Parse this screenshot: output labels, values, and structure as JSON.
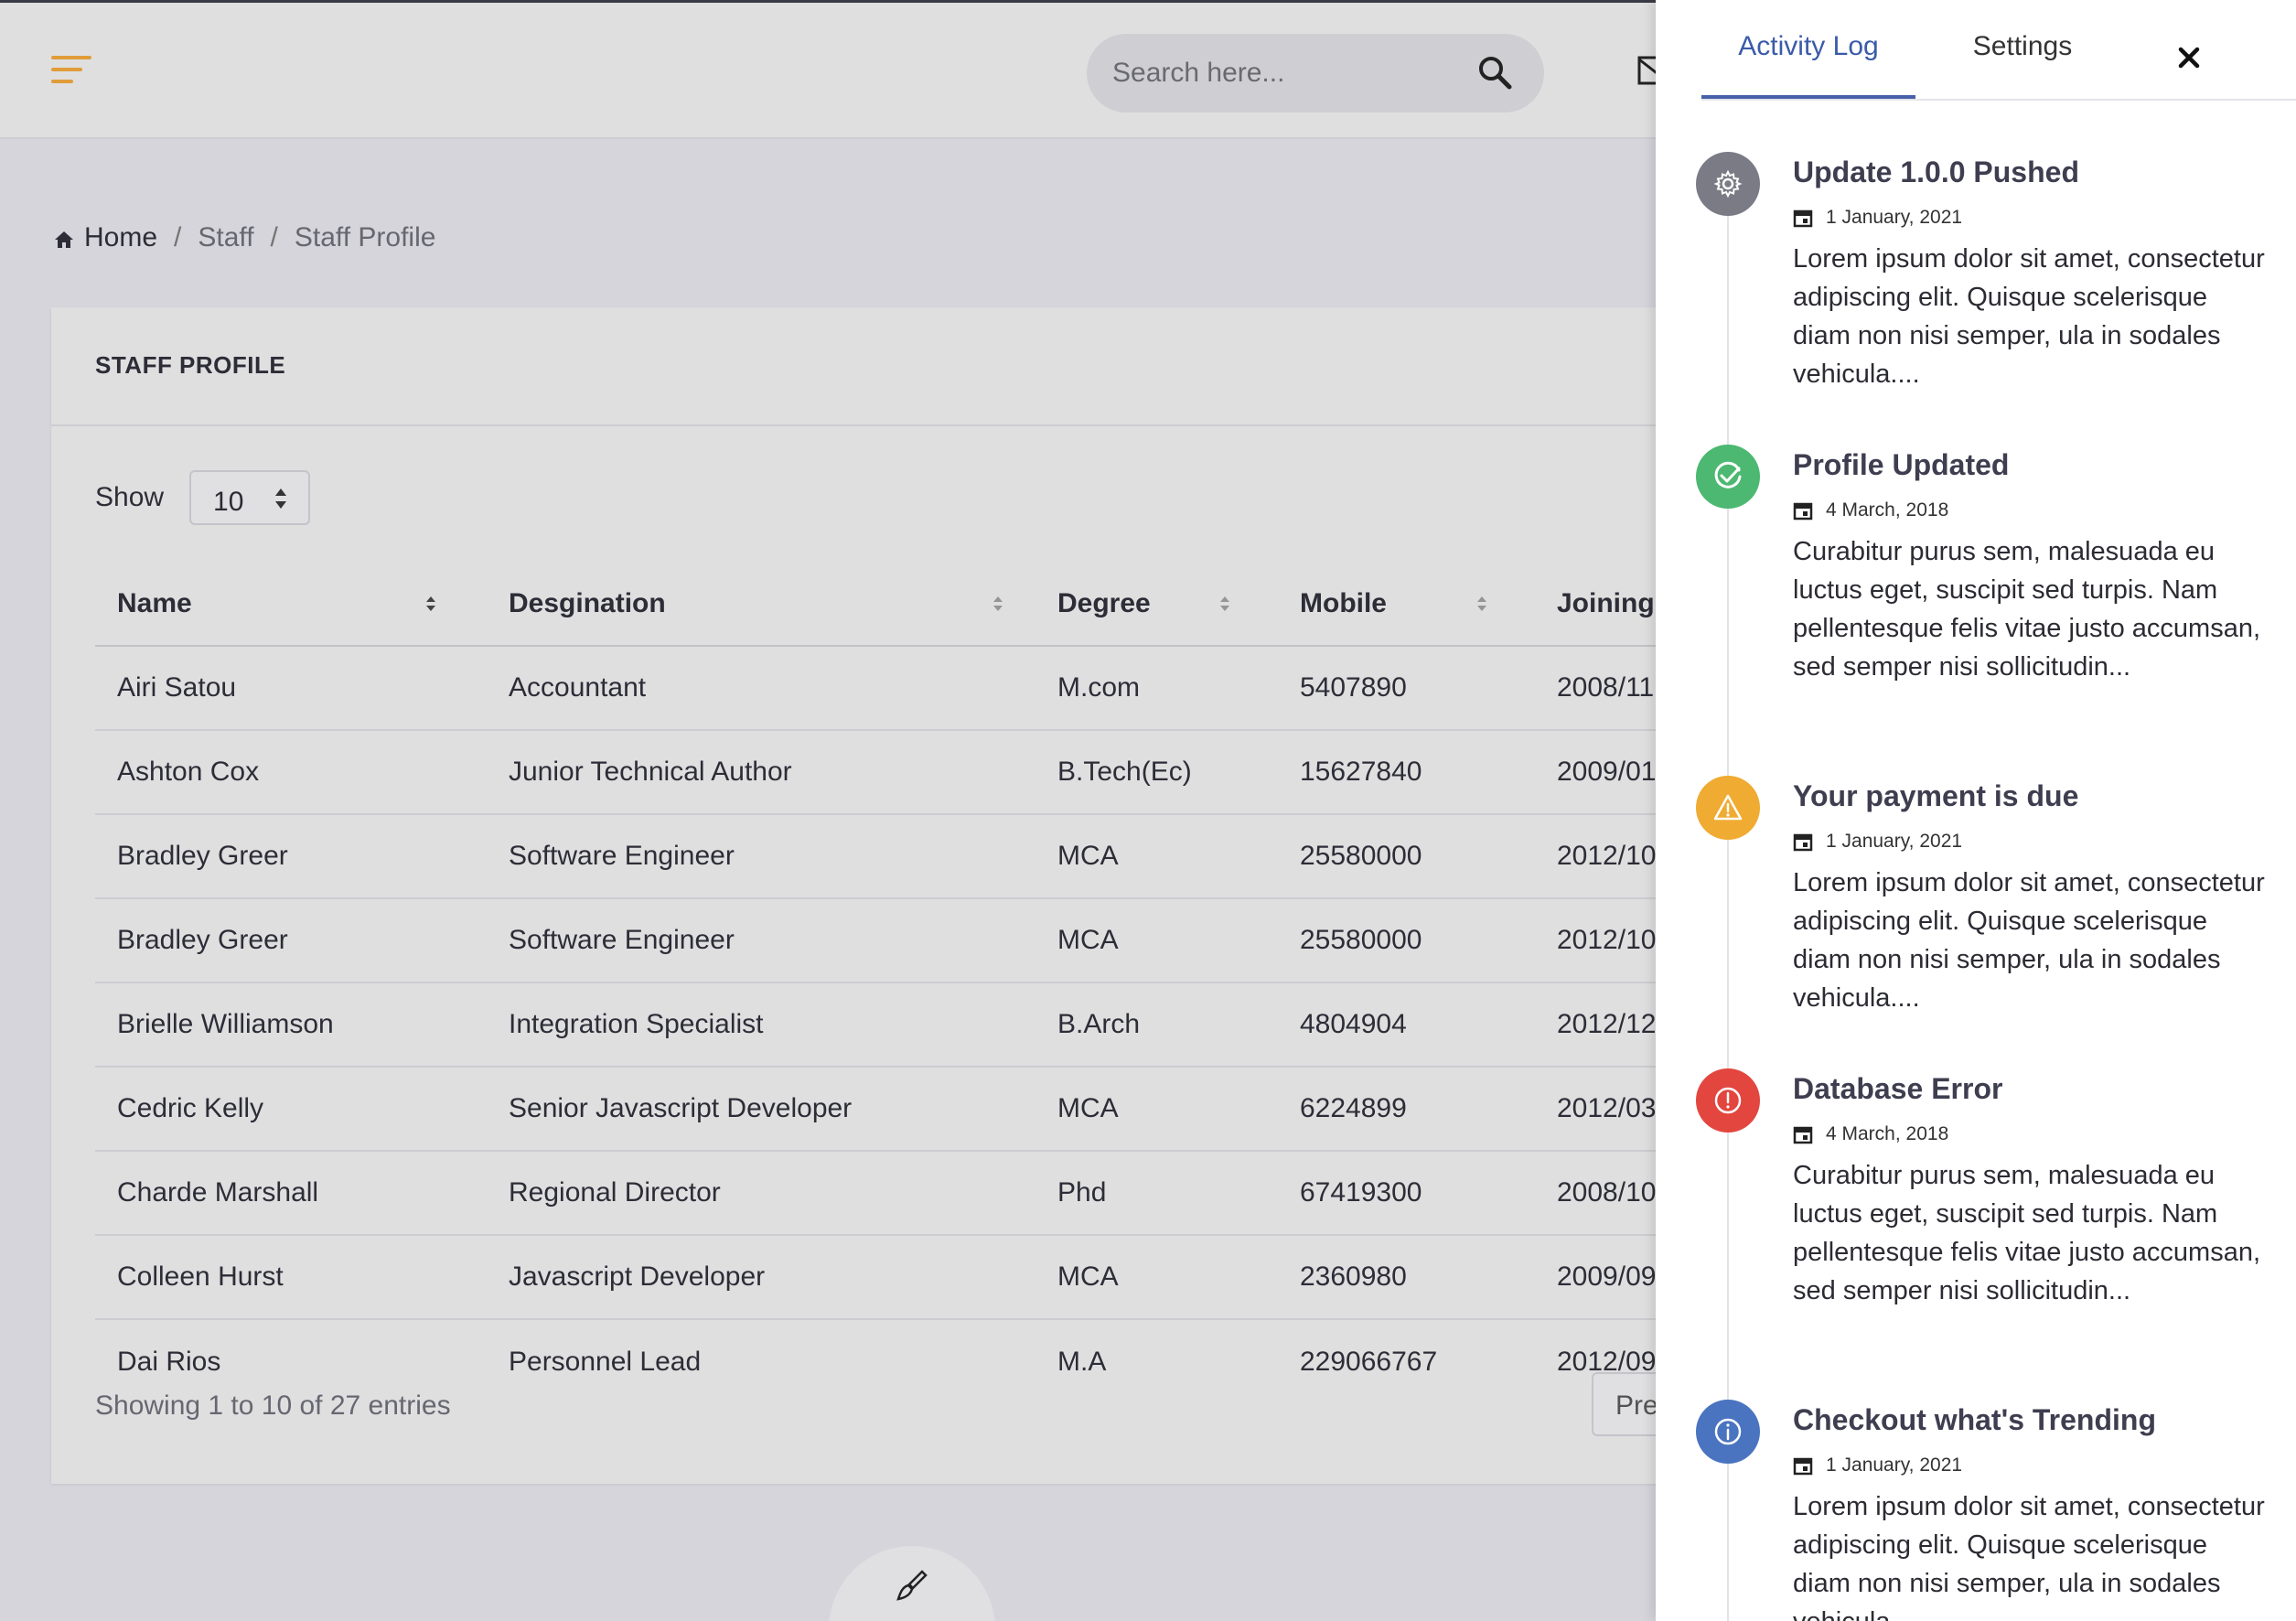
{
  "header": {
    "search_placeholder": "Search here..."
  },
  "breadcrumb": {
    "home": "Home",
    "sep": "/",
    "items": [
      "Staff",
      "Staff Profile"
    ]
  },
  "card": {
    "title": "STAFF PROFILE",
    "show_label": "Show",
    "page_size": "10",
    "columns": [
      "Name",
      "Desgination",
      "Degree",
      "Mobile",
      "Joining d"
    ],
    "rows": [
      [
        "Airi Satou",
        "Accountant",
        "M.com",
        "5407890",
        "2008/11"
      ],
      [
        "Ashton Cox",
        "Junior Technical Author",
        "B.Tech(Ec)",
        "15627840",
        "2009/01"
      ],
      [
        "Bradley Greer",
        "Software Engineer",
        "MCA",
        "25580000",
        "2012/10"
      ],
      [
        "Bradley Greer",
        "Software Engineer",
        "MCA",
        "25580000",
        "2012/10"
      ],
      [
        "Brielle Williamson",
        "Integration Specialist",
        "B.Arch",
        "4804904",
        "2012/12"
      ],
      [
        "Cedric Kelly",
        "Senior Javascript Developer",
        "MCA",
        "6224899",
        "2012/03"
      ],
      [
        "Charde Marshall",
        "Regional Director",
        "Phd",
        "67419300",
        "2008/10"
      ],
      [
        "Colleen Hurst",
        "Javascript Developer",
        "MCA",
        "2360980",
        "2009/09"
      ],
      [
        "Dai Rios",
        "Personnel Lead",
        "M.A",
        "229066767",
        "2012/09"
      ]
    ],
    "showing": "Showing 1 to 10 of 27 entries",
    "prev_label": "Previous"
  },
  "panel": {
    "tabs": [
      "Activity Log",
      "Settings"
    ],
    "close_label": "×",
    "events": [
      {
        "title": "Update 1.0.0 Pushed",
        "date": "1 January, 2021",
        "body": "Lorem ipsum dolor sit amet, consectetur adipiscing elit. Quisque scelerisque diam non nisi semper, ula in sodales vehicula....",
        "icon": "gear-icon",
        "color": "#7b7b86"
      },
      {
        "title": "Profile Updated",
        "date": "4 March, 2018",
        "body": "Curabitur purus sem, malesuada eu luctus eget, suscipit sed turpis. Nam pellentesque felis vitae justo accumsan, sed semper nisi sollicitudin...",
        "icon": "check-circle-icon",
        "color": "#4cb871"
      },
      {
        "title": "Your payment is due",
        "date": "1 January, 2021",
        "body": "Lorem ipsum dolor sit amet, consectetur adipiscing elit. Quisque scelerisque diam non nisi semper, ula in sodales vehicula....",
        "icon": "warning-icon",
        "color": "#efab32"
      },
      {
        "title": "Database Error",
        "date": "4 March, 2018",
        "body": "Curabitur purus sem, malesuada eu luctus eget, suscipit sed turpis. Nam pellentesque felis vitae justo accumsan, sed semper nisi sollicitudin...",
        "icon": "alert-circle-icon",
        "color": "#e2463f"
      },
      {
        "title": "Checkout what's Trending",
        "date": "1 January, 2021",
        "body": "Lorem ipsum dolor sit amet, consectetur adipiscing elit. Quisque scelerisque diam non nisi semper, ula in sodales vehicula....",
        "icon": "info-icon",
        "color": "#4a74c0"
      }
    ]
  },
  "colors": {
    "accent_orange": "#e8a23b",
    "tab_active": "#3a5ba8"
  }
}
